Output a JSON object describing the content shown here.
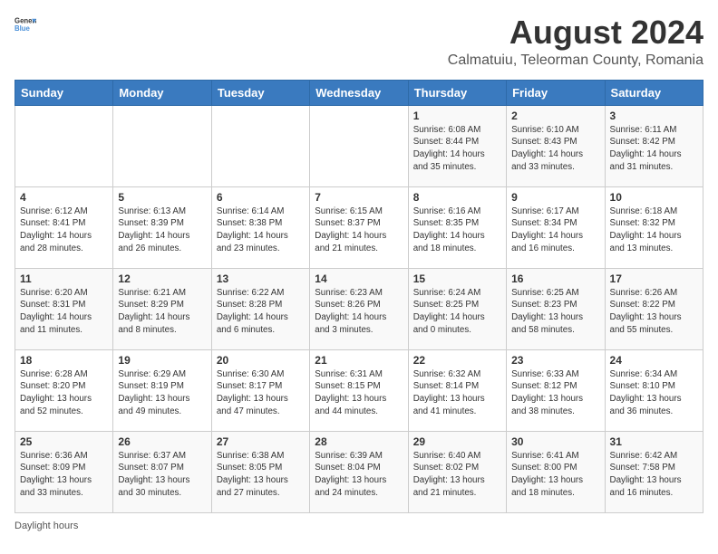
{
  "logo": {
    "text_general": "General",
    "text_blue": "Blue"
  },
  "title": {
    "month_year": "August 2024",
    "location": "Calmatuiu, Teleorman County, Romania"
  },
  "days_of_week": [
    "Sunday",
    "Monday",
    "Tuesday",
    "Wednesday",
    "Thursday",
    "Friday",
    "Saturday"
  ],
  "footer": {
    "daylight_label": "Daylight hours"
  },
  "weeks": [
    [
      {
        "day": "",
        "sunrise": "",
        "sunset": "",
        "daylight": ""
      },
      {
        "day": "",
        "sunrise": "",
        "sunset": "",
        "daylight": ""
      },
      {
        "day": "",
        "sunrise": "",
        "sunset": "",
        "daylight": ""
      },
      {
        "day": "",
        "sunrise": "",
        "sunset": "",
        "daylight": ""
      },
      {
        "day": "1",
        "sunrise": "Sunrise: 6:08 AM",
        "sunset": "Sunset: 8:44 PM",
        "daylight": "Daylight: 14 hours and 35 minutes."
      },
      {
        "day": "2",
        "sunrise": "Sunrise: 6:10 AM",
        "sunset": "Sunset: 8:43 PM",
        "daylight": "Daylight: 14 hours and 33 minutes."
      },
      {
        "day": "3",
        "sunrise": "Sunrise: 6:11 AM",
        "sunset": "Sunset: 8:42 PM",
        "daylight": "Daylight: 14 hours and 31 minutes."
      }
    ],
    [
      {
        "day": "4",
        "sunrise": "Sunrise: 6:12 AM",
        "sunset": "Sunset: 8:41 PM",
        "daylight": "Daylight: 14 hours and 28 minutes."
      },
      {
        "day": "5",
        "sunrise": "Sunrise: 6:13 AM",
        "sunset": "Sunset: 8:39 PM",
        "daylight": "Daylight: 14 hours and 26 minutes."
      },
      {
        "day": "6",
        "sunrise": "Sunrise: 6:14 AM",
        "sunset": "Sunset: 8:38 PM",
        "daylight": "Daylight: 14 hours and 23 minutes."
      },
      {
        "day": "7",
        "sunrise": "Sunrise: 6:15 AM",
        "sunset": "Sunset: 8:37 PM",
        "daylight": "Daylight: 14 hours and 21 minutes."
      },
      {
        "day": "8",
        "sunrise": "Sunrise: 6:16 AM",
        "sunset": "Sunset: 8:35 PM",
        "daylight": "Daylight: 14 hours and 18 minutes."
      },
      {
        "day": "9",
        "sunrise": "Sunrise: 6:17 AM",
        "sunset": "Sunset: 8:34 PM",
        "daylight": "Daylight: 14 hours and 16 minutes."
      },
      {
        "day": "10",
        "sunrise": "Sunrise: 6:18 AM",
        "sunset": "Sunset: 8:32 PM",
        "daylight": "Daylight: 14 hours and 13 minutes."
      }
    ],
    [
      {
        "day": "11",
        "sunrise": "Sunrise: 6:20 AM",
        "sunset": "Sunset: 8:31 PM",
        "daylight": "Daylight: 14 hours and 11 minutes."
      },
      {
        "day": "12",
        "sunrise": "Sunrise: 6:21 AM",
        "sunset": "Sunset: 8:29 PM",
        "daylight": "Daylight: 14 hours and 8 minutes."
      },
      {
        "day": "13",
        "sunrise": "Sunrise: 6:22 AM",
        "sunset": "Sunset: 8:28 PM",
        "daylight": "Daylight: 14 hours and 6 minutes."
      },
      {
        "day": "14",
        "sunrise": "Sunrise: 6:23 AM",
        "sunset": "Sunset: 8:26 PM",
        "daylight": "Daylight: 14 hours and 3 minutes."
      },
      {
        "day": "15",
        "sunrise": "Sunrise: 6:24 AM",
        "sunset": "Sunset: 8:25 PM",
        "daylight": "Daylight: 14 hours and 0 minutes."
      },
      {
        "day": "16",
        "sunrise": "Sunrise: 6:25 AM",
        "sunset": "Sunset: 8:23 PM",
        "daylight": "Daylight: 13 hours and 58 minutes."
      },
      {
        "day": "17",
        "sunrise": "Sunrise: 6:26 AM",
        "sunset": "Sunset: 8:22 PM",
        "daylight": "Daylight: 13 hours and 55 minutes."
      }
    ],
    [
      {
        "day": "18",
        "sunrise": "Sunrise: 6:28 AM",
        "sunset": "Sunset: 8:20 PM",
        "daylight": "Daylight: 13 hours and 52 minutes."
      },
      {
        "day": "19",
        "sunrise": "Sunrise: 6:29 AM",
        "sunset": "Sunset: 8:19 PM",
        "daylight": "Daylight: 13 hours and 49 minutes."
      },
      {
        "day": "20",
        "sunrise": "Sunrise: 6:30 AM",
        "sunset": "Sunset: 8:17 PM",
        "daylight": "Daylight: 13 hours and 47 minutes."
      },
      {
        "day": "21",
        "sunrise": "Sunrise: 6:31 AM",
        "sunset": "Sunset: 8:15 PM",
        "daylight": "Daylight: 13 hours and 44 minutes."
      },
      {
        "day": "22",
        "sunrise": "Sunrise: 6:32 AM",
        "sunset": "Sunset: 8:14 PM",
        "daylight": "Daylight: 13 hours and 41 minutes."
      },
      {
        "day": "23",
        "sunrise": "Sunrise: 6:33 AM",
        "sunset": "Sunset: 8:12 PM",
        "daylight": "Daylight: 13 hours and 38 minutes."
      },
      {
        "day": "24",
        "sunrise": "Sunrise: 6:34 AM",
        "sunset": "Sunset: 8:10 PM",
        "daylight": "Daylight: 13 hours and 36 minutes."
      }
    ],
    [
      {
        "day": "25",
        "sunrise": "Sunrise: 6:36 AM",
        "sunset": "Sunset: 8:09 PM",
        "daylight": "Daylight: 13 hours and 33 minutes."
      },
      {
        "day": "26",
        "sunrise": "Sunrise: 6:37 AM",
        "sunset": "Sunset: 8:07 PM",
        "daylight": "Daylight: 13 hours and 30 minutes."
      },
      {
        "day": "27",
        "sunrise": "Sunrise: 6:38 AM",
        "sunset": "Sunset: 8:05 PM",
        "daylight": "Daylight: 13 hours and 27 minutes."
      },
      {
        "day": "28",
        "sunrise": "Sunrise: 6:39 AM",
        "sunset": "Sunset: 8:04 PM",
        "daylight": "Daylight: 13 hours and 24 minutes."
      },
      {
        "day": "29",
        "sunrise": "Sunrise: 6:40 AM",
        "sunset": "Sunset: 8:02 PM",
        "daylight": "Daylight: 13 hours and 21 minutes."
      },
      {
        "day": "30",
        "sunrise": "Sunrise: 6:41 AM",
        "sunset": "Sunset: 8:00 PM",
        "daylight": "Daylight: 13 hours and 18 minutes."
      },
      {
        "day": "31",
        "sunrise": "Sunrise: 6:42 AM",
        "sunset": "Sunset: 7:58 PM",
        "daylight": "Daylight: 13 hours and 16 minutes."
      }
    ]
  ]
}
